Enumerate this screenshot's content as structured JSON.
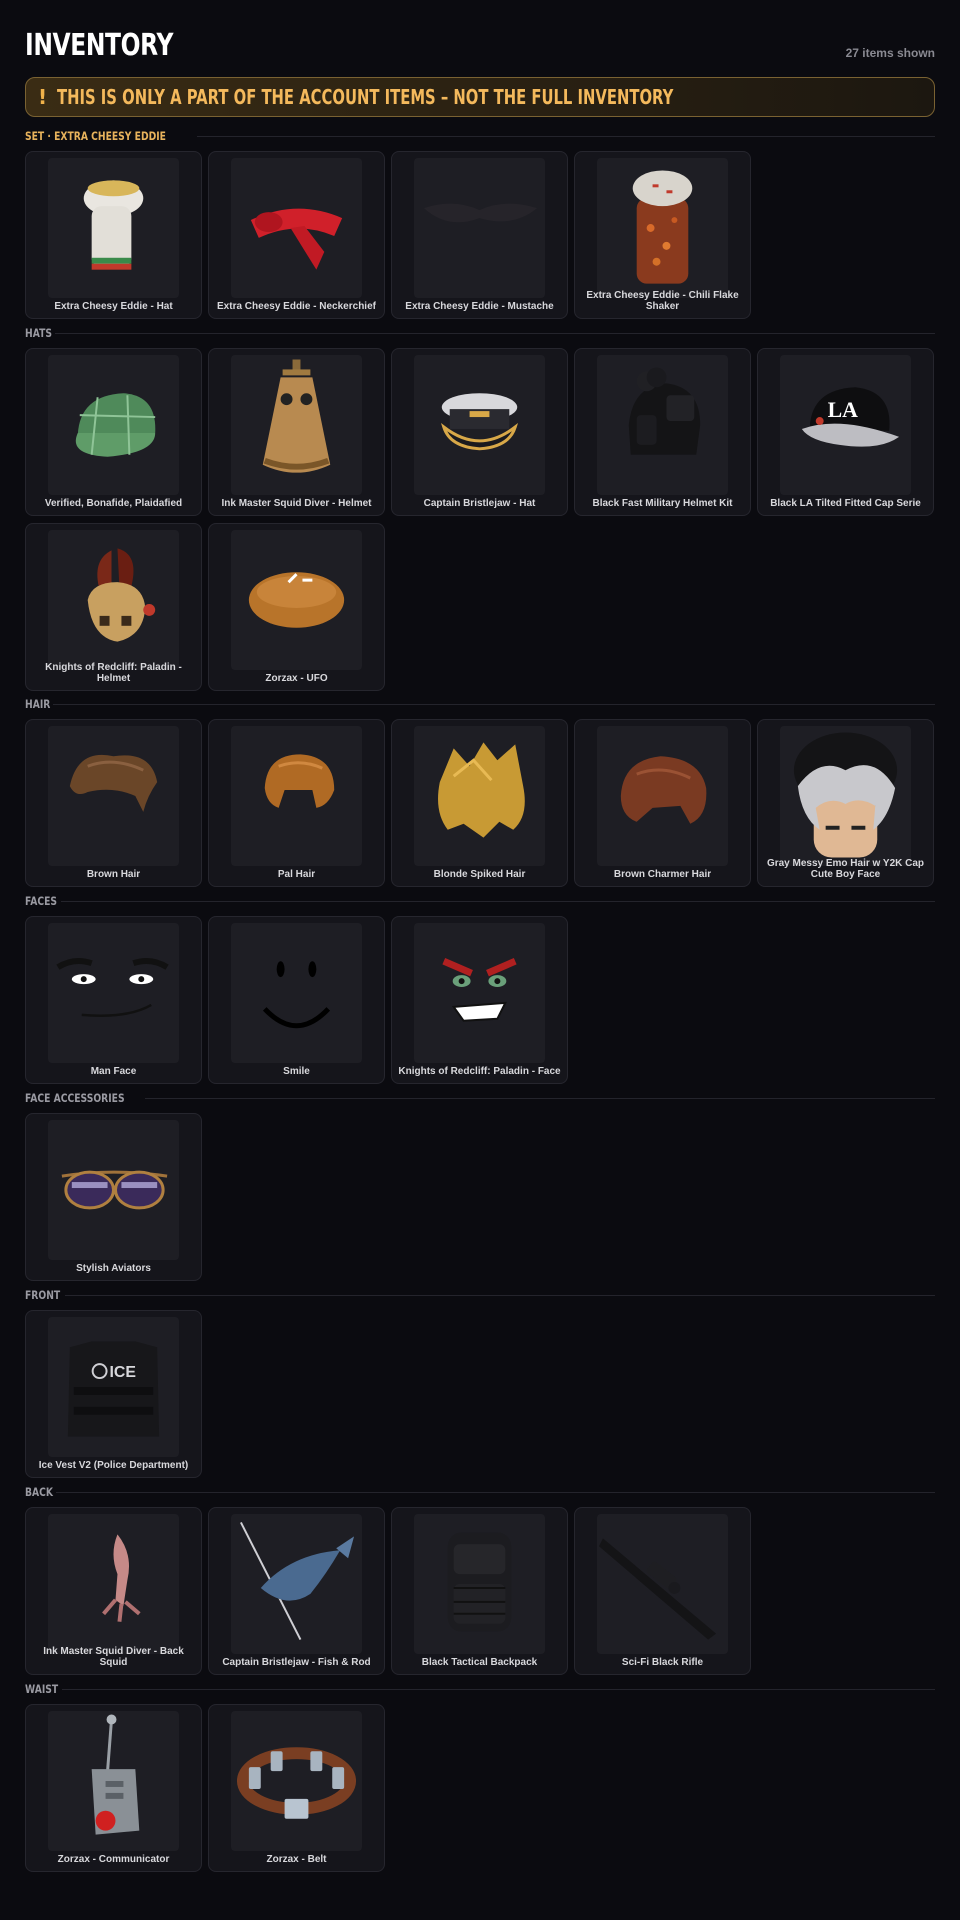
{
  "header": {
    "title": "INVENTORY",
    "items_count": "27 items shown"
  },
  "banner": {
    "icon": "!",
    "text": "THIS IS ONLY A PART OF THE ACCOUNT ITEMS – NOT THE FULL INVENTORY"
  },
  "colors": {
    "background": "#0b0b10",
    "accent": "#f4b95c",
    "card": "#15151b"
  },
  "sections": [
    {
      "label": "SET · EXTRA CHEESY EDDIE",
      "items": [
        {
          "name": "Extra Cheesy Eddie - Hat",
          "icon": "chef-hat"
        },
        {
          "name": "Extra Cheesy Eddie - Neckerchief",
          "icon": "neckerchief"
        },
        {
          "name": "Extra Cheesy Eddie - Mustache",
          "icon": "mustache"
        },
        {
          "name": "Extra Cheesy Eddie - Chili Flake Shaker",
          "icon": "shaker"
        }
      ]
    },
    {
      "label": "HATS",
      "items": [
        {
          "name": "Verified, Bonafide, Plaidafied",
          "icon": "plaid-cap"
        },
        {
          "name": "Ink Master Squid Diver - Helmet",
          "icon": "diver-helmet"
        },
        {
          "name": "Captain Bristlejaw - Hat",
          "icon": "captain-hat"
        },
        {
          "name": "Black Fast Military Helmet Kit",
          "icon": "military-helmet"
        },
        {
          "name": "Black LA Tilted Fitted Cap Serie",
          "icon": "la-cap"
        },
        {
          "name": "Knights of Redcliff: Paladin - Helmet",
          "icon": "paladin-helmet"
        },
        {
          "name": "Zorzax - UFO",
          "icon": "ufo"
        }
      ]
    },
    {
      "label": "HAIR",
      "items": [
        {
          "name": "Brown Hair",
          "icon": "brown-hair"
        },
        {
          "name": "Pal Hair",
          "icon": "pal-hair"
        },
        {
          "name": "Blonde Spiked Hair",
          "icon": "blonde-hair"
        },
        {
          "name": "Brown Charmer Hair",
          "icon": "charmer-hair"
        },
        {
          "name": "Gray Messy Emo Hair w Y2K Cap Cute Boy Face",
          "icon": "emo-hair"
        }
      ]
    },
    {
      "label": "FACES",
      "items": [
        {
          "name": "Man Face",
          "icon": "man-face"
        },
        {
          "name": "Smile",
          "icon": "smile-face"
        },
        {
          "name": "Knights of Redcliff: Paladin - Face",
          "icon": "paladin-face"
        }
      ]
    },
    {
      "label": "FACE ACCESSORIES",
      "items": [
        {
          "name": "Stylish Aviators",
          "icon": "aviators"
        }
      ]
    },
    {
      "label": "FRONT",
      "items": [
        {
          "name": "Ice Vest V2 (Police Department)",
          "icon": "ice-vest",
          "badge": "ICE"
        }
      ]
    },
    {
      "label": "BACK",
      "items": [
        {
          "name": "Ink Master Squid Diver - Back Squid",
          "icon": "back-squid"
        },
        {
          "name": "Captain Bristlejaw - Fish & Rod",
          "icon": "fish-rod"
        },
        {
          "name": "Black Tactical Backpack",
          "icon": "backpack"
        },
        {
          "name": "Sci-Fi Black Rifle",
          "icon": "rifle"
        }
      ]
    },
    {
      "label": "WAIST",
      "items": [
        {
          "name": "Zorzax - Communicator",
          "icon": "communicator"
        },
        {
          "name": "Zorzax - Belt",
          "icon": "belt"
        }
      ]
    }
  ]
}
